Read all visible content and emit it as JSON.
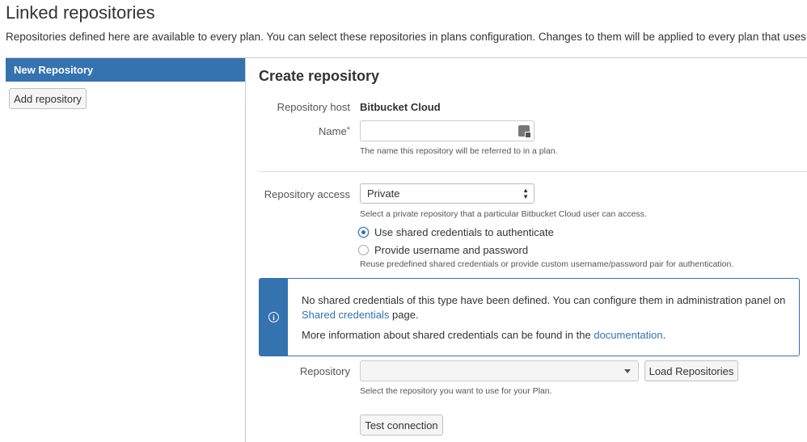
{
  "page": {
    "title": "Linked repositories",
    "description": "Repositories defined here are available to every plan. You can select these repositories in plans configuration. Changes to them will be applied to every plan that uses them."
  },
  "sidebar": {
    "selected_item": "New Repository",
    "add_button": "Add repository"
  },
  "form": {
    "title": "Create repository",
    "host_label": "Repository host",
    "host_value": "Bitbucket Cloud",
    "name_label": "Name",
    "name_required_mark": "*",
    "name_value": "",
    "name_help": "The name this repository will be referred to in a plan.",
    "access_label": "Repository access",
    "access_value": "Private",
    "access_help": "Select a private repository that a particular Bitbucket Cloud user can access.",
    "radio_shared": "Use shared credentials to authenticate",
    "radio_userpass": "Provide username and password",
    "radio_selected": "shared",
    "auth_help": "Reuse predefined shared credentials or provide custom username/password pair for authentication.",
    "info": {
      "line1_text": "No shared credentials of this type have been defined. You can configure them in administration panel on",
      "line1_link": "Shared credentials",
      "line1_tail": " page.",
      "line2_text": "More information about shared credentials can be found in the ",
      "line2_link": "documentation",
      "line2_tail": "."
    },
    "repository_label": "Repository",
    "repository_value": "",
    "load_button": "Load Repositories",
    "repository_help": "Select the repository you want to use for your Plan.",
    "test_button": "Test connection"
  },
  "colors": {
    "accent": "#3572b0",
    "required": "#d04437"
  }
}
